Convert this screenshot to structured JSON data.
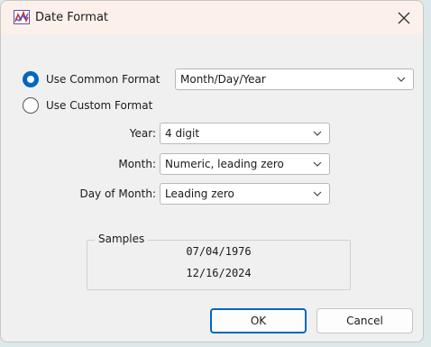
{
  "window": {
    "title": "Date Format",
    "close_glyph": "✕",
    "app_icon": "origin-graph-icon"
  },
  "format_mode": {
    "common": {
      "label": "Use Common Format",
      "selected": true,
      "value": "Month/Day/Year"
    },
    "custom": {
      "label": "Use Custom Format",
      "selected": false
    }
  },
  "custom_fields": {
    "year": {
      "label": "Year:",
      "value": "4 digit"
    },
    "month": {
      "label": "Month:",
      "value": "Numeric, leading zero"
    },
    "day": {
      "label": "Day of Month:",
      "value": "Leading zero"
    }
  },
  "samples": {
    "title": "Samples",
    "values": [
      "07/04/1976",
      "12/16/2024"
    ]
  },
  "buttons": {
    "ok": "OK",
    "cancel": "Cancel"
  },
  "colors": {
    "accent": "#0067c0",
    "titlebar": "#fbf1ea",
    "dialog_bg": "#f0f0f0",
    "desktop_bg": "#dde8ea"
  }
}
